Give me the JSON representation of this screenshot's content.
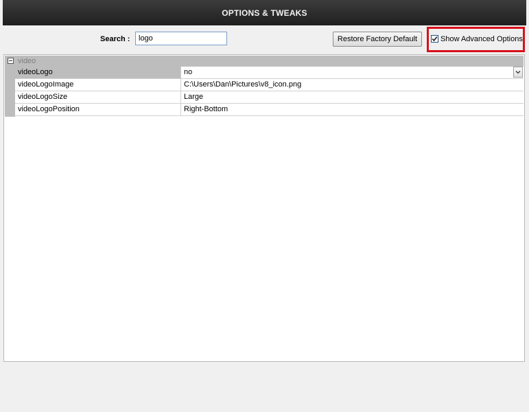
{
  "window": {
    "title": "OPTIONS & TWEAKS"
  },
  "search": {
    "label": "Search :",
    "value": "logo"
  },
  "toolbar": {
    "restore_label": "Restore Factory Default",
    "show_advanced_label": "Show Advanced Options",
    "show_advanced_checked": true,
    "highlight_color": "#d8101a"
  },
  "property_grid": {
    "group": {
      "label": "video",
      "expanded": true
    },
    "rows": [
      {
        "name": "videoLogo",
        "value": "no",
        "editor": "dropdown",
        "selected": true
      },
      {
        "name": "videoLogoImage",
        "value": "C:\\Users\\Dan\\Pictures\\v8_icon.png"
      },
      {
        "name": "videoLogoSize",
        "value": "Large"
      },
      {
        "name": "videoLogoPosition",
        "value": "Right-Bottom"
      }
    ]
  }
}
